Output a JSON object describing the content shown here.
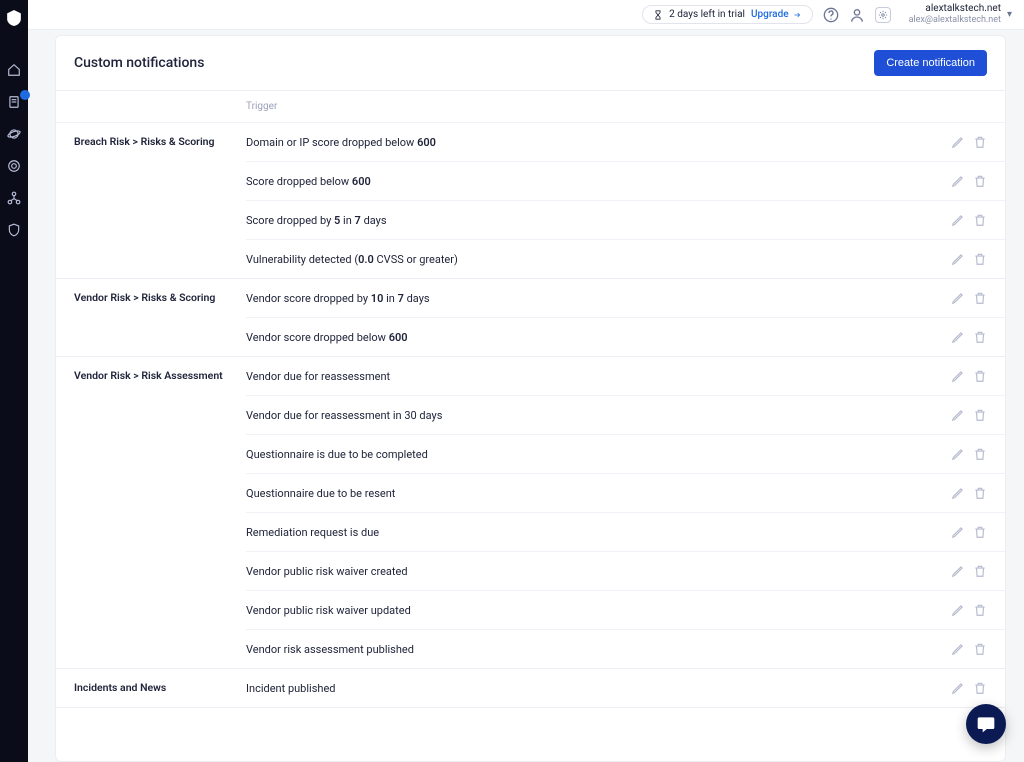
{
  "header": {
    "trial_text": "2 days left in trial",
    "upgrade_text": "Upgrade",
    "org": "alextalkstech.net",
    "email": "alex@alextalkstech.net"
  },
  "sidebar": {
    "items": [
      {
        "name": "logo-icon"
      },
      {
        "name": "home-icon"
      },
      {
        "name": "report-icon",
        "badge": ""
      },
      {
        "name": "planet-icon"
      },
      {
        "name": "target-icon"
      },
      {
        "name": "hierarchy-icon"
      },
      {
        "name": "shield-icon"
      }
    ]
  },
  "page": {
    "title": "Custom notifications",
    "create_button": "Create notification",
    "trigger_header": "Trigger"
  },
  "sections": [
    {
      "category": "Breach Risk > Risks & Scoring",
      "rows": [
        {
          "parts": [
            "Domain or IP score dropped below ",
            "<b>600</b>"
          ]
        },
        {
          "parts": [
            "Score dropped below ",
            "<b>600</b>"
          ]
        },
        {
          "parts": [
            "Score dropped by ",
            "<b>5</b>",
            " in ",
            "<b>7</b>",
            " days"
          ]
        },
        {
          "parts": [
            "Vulnerability detected (",
            "<b>0.0</b>",
            " CVSS or greater)"
          ]
        }
      ]
    },
    {
      "category": "Vendor Risk > Risks & Scoring",
      "rows": [
        {
          "parts": [
            "Vendor score dropped by ",
            "<b>10</b>",
            " in ",
            "<b>7</b>",
            " days"
          ]
        },
        {
          "parts": [
            "Vendor score dropped below ",
            "<b>600</b>"
          ]
        }
      ]
    },
    {
      "category": "Vendor Risk > Risk Assessment",
      "rows": [
        {
          "parts": [
            "Vendor due for reassessment"
          ]
        },
        {
          "parts": [
            "Vendor due for reassessment in 30 days"
          ]
        },
        {
          "parts": [
            "Questionnaire is due to be completed"
          ]
        },
        {
          "parts": [
            "Questionnaire due to be resent"
          ]
        },
        {
          "parts": [
            "Remediation request is due"
          ]
        },
        {
          "parts": [
            "Vendor public risk waiver created"
          ]
        },
        {
          "parts": [
            "Vendor public risk waiver updated"
          ]
        },
        {
          "parts": [
            "Vendor risk assessment published"
          ]
        }
      ]
    },
    {
      "category": "Incidents and News",
      "rows": [
        {
          "parts": [
            "Incident published"
          ]
        }
      ]
    }
  ]
}
